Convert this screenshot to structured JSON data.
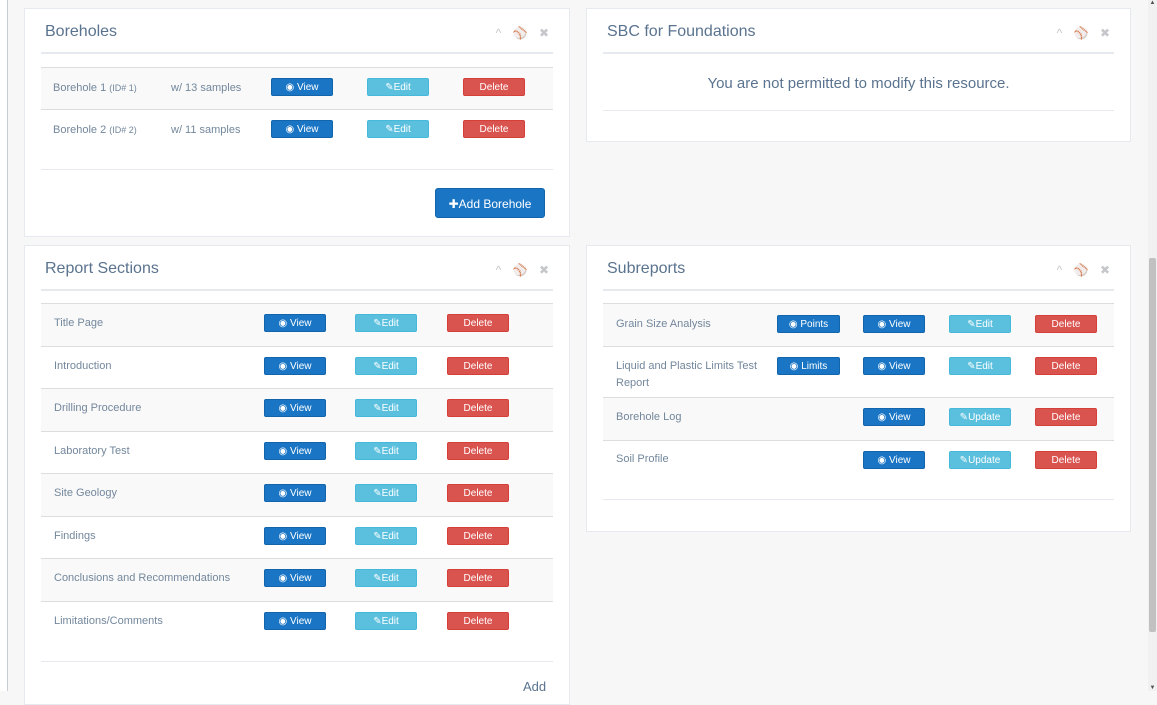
{
  "boreholes": {
    "title": "Boreholes",
    "rows": [
      {
        "name": "Borehole 1",
        "id": "(ID# 1)",
        "samples": "w/ 13 samples"
      },
      {
        "name": "Borehole 2",
        "id": "(ID# 2)",
        "samples": "w/ 11 samples"
      }
    ],
    "add_label": "Add Borehole"
  },
  "sbc": {
    "title": "SBC for Foundations",
    "notice": "You are not permitted to modify this resource."
  },
  "report_sections": {
    "title": "Report Sections",
    "rows": [
      {
        "name": "Title Page"
      },
      {
        "name": "Introduction"
      },
      {
        "name": "Drilling Procedure"
      },
      {
        "name": "Laboratory Test"
      },
      {
        "name": "Site Geology"
      },
      {
        "name": "Findings"
      },
      {
        "name": "Conclusions and Recommendations"
      },
      {
        "name": "Limitations/Comments"
      }
    ],
    "add_label": "Add"
  },
  "subreports": {
    "title": "Subreports",
    "rows": [
      {
        "name": "Grain Size Analysis",
        "extra": "Points",
        "edit": "Edit"
      },
      {
        "name_line1": "Liquid and Plastic Limits Test",
        "name_line2": "Report",
        "extra": "Limits",
        "edit": "Edit"
      },
      {
        "name": "Borehole Log",
        "edit": "Update"
      },
      {
        "name": "Soil Profile",
        "edit": "Update"
      }
    ]
  },
  "buttons": {
    "view": "View",
    "edit": "Edit",
    "delete": "Delete"
  },
  "icons": {
    "collapse": "chevron-up-icon",
    "settings": "wrench-icon",
    "close": "close-icon",
    "view": "eye-icon",
    "edit": "pencil-icon",
    "add": "plus-icon"
  },
  "colors": {
    "primary": "#1a76c5",
    "info": "#5bc0de",
    "danger": "#d9534f",
    "title": "#5a738e"
  }
}
